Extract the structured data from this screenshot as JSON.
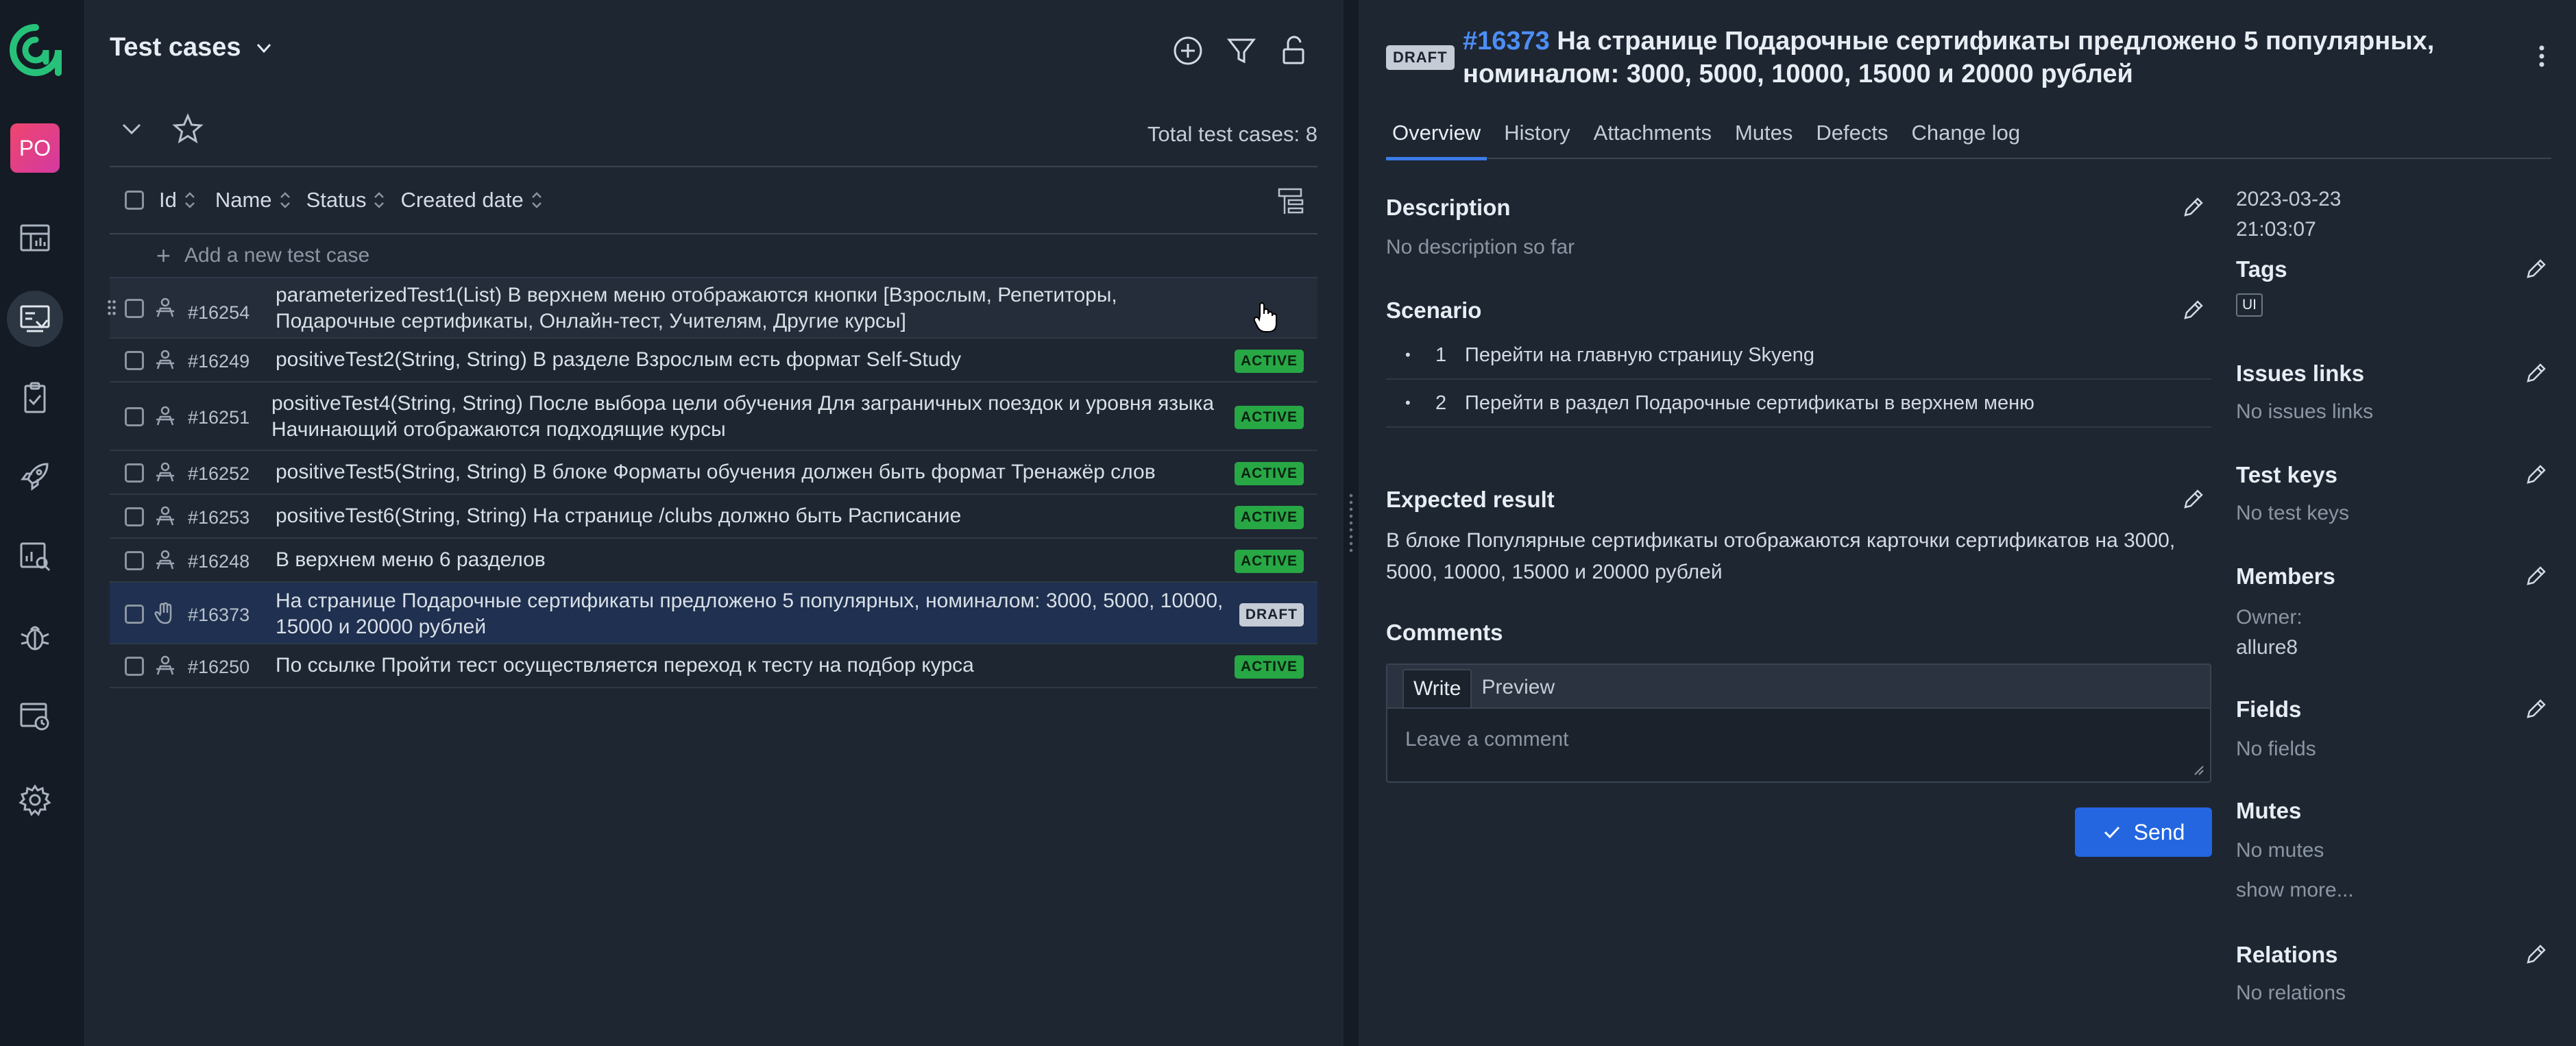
{
  "app": {
    "avatar_initials": "PO",
    "accent": "#3c7be8"
  },
  "list": {
    "title": "Test cases",
    "total_label": "Total test cases: 8",
    "columns": [
      "Id",
      "Name",
      "Status",
      "Created date"
    ],
    "add_label": "Add a new test case",
    "rows": [
      {
        "id": "#16254",
        "name": "parameterizedTest1(List) В верхнем меню отображаются кнопки [Взрослым, Репетиторы, Подарочные сертификаты, Онлайн-тест, Учителям, Другие курсы]",
        "status": ""
      },
      {
        "id": "#16249",
        "name": "positiveTest2(String, String) В разделе Взрослым есть формат Self-Study",
        "status": "ACTIVE"
      },
      {
        "id": "#16251",
        "name": "positiveTest4(String, String) После выбора цели обучения Для заграничных поездок и уровня языка Начинающий отображаются подходящие курсы",
        "status": "ACTIVE"
      },
      {
        "id": "#16252",
        "name": "positiveTest5(String, String) В блоке Форматы обучения должен быть формат Тренажёр слов",
        "status": "ACTIVE"
      },
      {
        "id": "#16253",
        "name": "positiveTest6(String, String) На странице /clubs должно быть Расписание",
        "status": "ACTIVE"
      },
      {
        "id": "#16248",
        "name": "В верхнем меню 6 разделов",
        "status": "ACTIVE"
      },
      {
        "id": "#16373",
        "name": "На странице Подарочные сертификаты предложено 5 популярных, номиналом: 3000, 5000, 10000, 15000 и 20000 рублей",
        "status": "DRAFT"
      },
      {
        "id": "#16250",
        "name": "По ссылке Пройти тест осуществляется переход к тесту на подбор курса",
        "status": "ACTIVE"
      }
    ]
  },
  "detail": {
    "badge": "DRAFT",
    "id": "#16373",
    "title": "На странице Подарочные сертификаты предложено 5 популярных, номиналом: 3000, 5000, 10000, 15000 и 20000 рублей",
    "tabs": [
      "Overview",
      "History",
      "Attachments",
      "Mutes",
      "Defects",
      "Change log"
    ],
    "description_title": "Description",
    "description_value": "No description so far",
    "scenario_title": "Scenario",
    "scenario": [
      {
        "num": "1",
        "text": "Перейти на главную страницу Skyeng"
      },
      {
        "num": "2",
        "text": "Перейти в раздел Подарочные сертификаты в верхнем меню"
      }
    ],
    "expected_title": "Expected result",
    "expected_value": "В блоке Популярные сертификаты отображаются карточки сертификатов на 3000, 5000, 10000, 15000 и 20000 рублей",
    "comments_title": "Comments",
    "comment_write": "Write",
    "comment_preview": "Preview",
    "comment_placeholder": "Leave a comment",
    "send_label": "Send",
    "created_date": "2023-03-23",
    "created_time": "21:03:07",
    "tags_title": "Tags",
    "tag_ui": "UI",
    "issues_title": "Issues links",
    "issues_value": "No issues links",
    "keys_title": "Test keys",
    "keys_value": "No test keys",
    "members_title": "Members",
    "owner_label": "Owner:",
    "owner_value": "allure8",
    "fields_title": "Fields",
    "fields_value": "No fields",
    "mutes_title": "Mutes",
    "mutes_value": "No mutes",
    "show_more": "show more...",
    "relations_title": "Relations",
    "relations_value": "No relations"
  }
}
